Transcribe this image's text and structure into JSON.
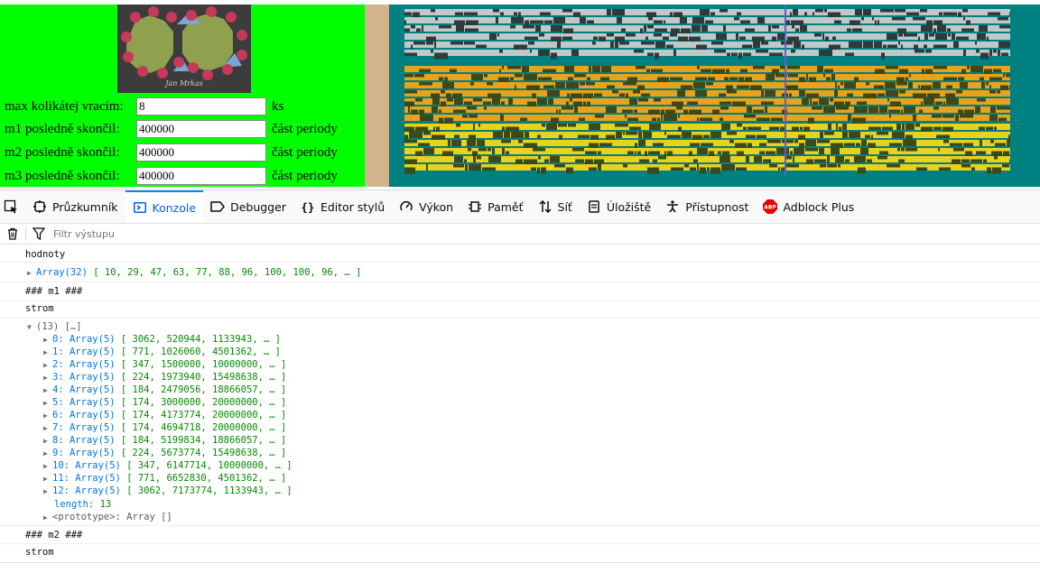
{
  "form": {
    "max_label": "max kolikátej vracím:",
    "max_value": "8",
    "max_unit": "ks",
    "m1_label": "m1 posledně skončil:",
    "m1_value": "400000",
    "m1_unit": "část periody",
    "m2_label": "m2 posledně skončil:",
    "m2_value": "400000",
    "m2_unit": "část periody",
    "m3_label": "m3 posledně skončil:",
    "m3_value": "400000",
    "m3_unit": "část periody"
  },
  "logo": {
    "signature": "Jan Mrkas"
  },
  "devtools": {
    "tabs": [
      {
        "label": "Průzkumník",
        "icon": "inspector-icon"
      },
      {
        "label": "Konzole",
        "icon": "console-icon"
      },
      {
        "label": "Debugger",
        "icon": "debugger-icon"
      },
      {
        "label": "Editor stylů",
        "icon": "style-editor-icon"
      },
      {
        "label": "Výkon",
        "icon": "performance-icon"
      },
      {
        "label": "Paměť",
        "icon": "memory-icon"
      },
      {
        "label": "Síť",
        "icon": "network-icon"
      },
      {
        "label": "Úložiště",
        "icon": "storage-icon"
      },
      {
        "label": "Přístupnost",
        "icon": "accessibility-icon"
      },
      {
        "label": "Adblock Plus",
        "icon": "adblock-icon"
      }
    ],
    "active_tab": "Konzole",
    "filter_placeholder": "Filtr výstupu"
  },
  "console": {
    "hodnoty_label": "hodnoty",
    "hodnoty_array": "Array(32)",
    "hodnoty_values": "[ 10, 29, 47, 63, 77, 88, 96, 100, 100, 96, … ]",
    "m1_heading": "### m1 ###",
    "strom1_label": "strom",
    "strom1_count": "(13) […]",
    "rows": [
      {
        "key": "0:",
        "type": "Array(5)",
        "values": "[ 3062, 520944, 1133943, … ]"
      },
      {
        "key": "1:",
        "type": "Array(5)",
        "values": "[ 771, 1026060, 4501362, … ]"
      },
      {
        "key": "2:",
        "type": "Array(5)",
        "values": "[ 347, 1500000, 10000000, … ]"
      },
      {
        "key": "3:",
        "type": "Array(5)",
        "values": "[ 224, 1973940, 15498638, … ]"
      },
      {
        "key": "4:",
        "type": "Array(5)",
        "values": "[ 184, 2479056, 18866057, … ]"
      },
      {
        "key": "5:",
        "type": "Array(5)",
        "values": "[ 174, 3000000, 20000000, … ]"
      },
      {
        "key": "6:",
        "type": "Array(5)",
        "values": "[ 174, 4173774, 20000000, … ]"
      },
      {
        "key": "7:",
        "type": "Array(5)",
        "values": "[ 174, 4694718, 20000000, … ]"
      },
      {
        "key": "8:",
        "type": "Array(5)",
        "values": "[ 184, 5199834, 18866057, … ]"
      },
      {
        "key": "9:",
        "type": "Array(5)",
        "values": "[ 224, 5673774, 15498638, … ]"
      },
      {
        "key": "10:",
        "type": "Array(5)",
        "values": "[ 347, 6147714, 10000000, … ]"
      },
      {
        "key": "11:",
        "type": "Array(5)",
        "values": "[ 771, 6652830, 4501362, … ]"
      },
      {
        "key": "12:",
        "type": "Array(5)",
        "values": "[ 3062, 7173774, 1133943, … ]"
      }
    ],
    "length_key": "length:",
    "length_value": "13",
    "prototype_label": "<prototype>: Array []",
    "m2_heading": "### m2 ###",
    "strom2_label": "strom"
  },
  "colors": {
    "page_green": "#00ff00",
    "teal": "#008080",
    "tan": "#d2b48c",
    "accent": "#0a84ff"
  }
}
